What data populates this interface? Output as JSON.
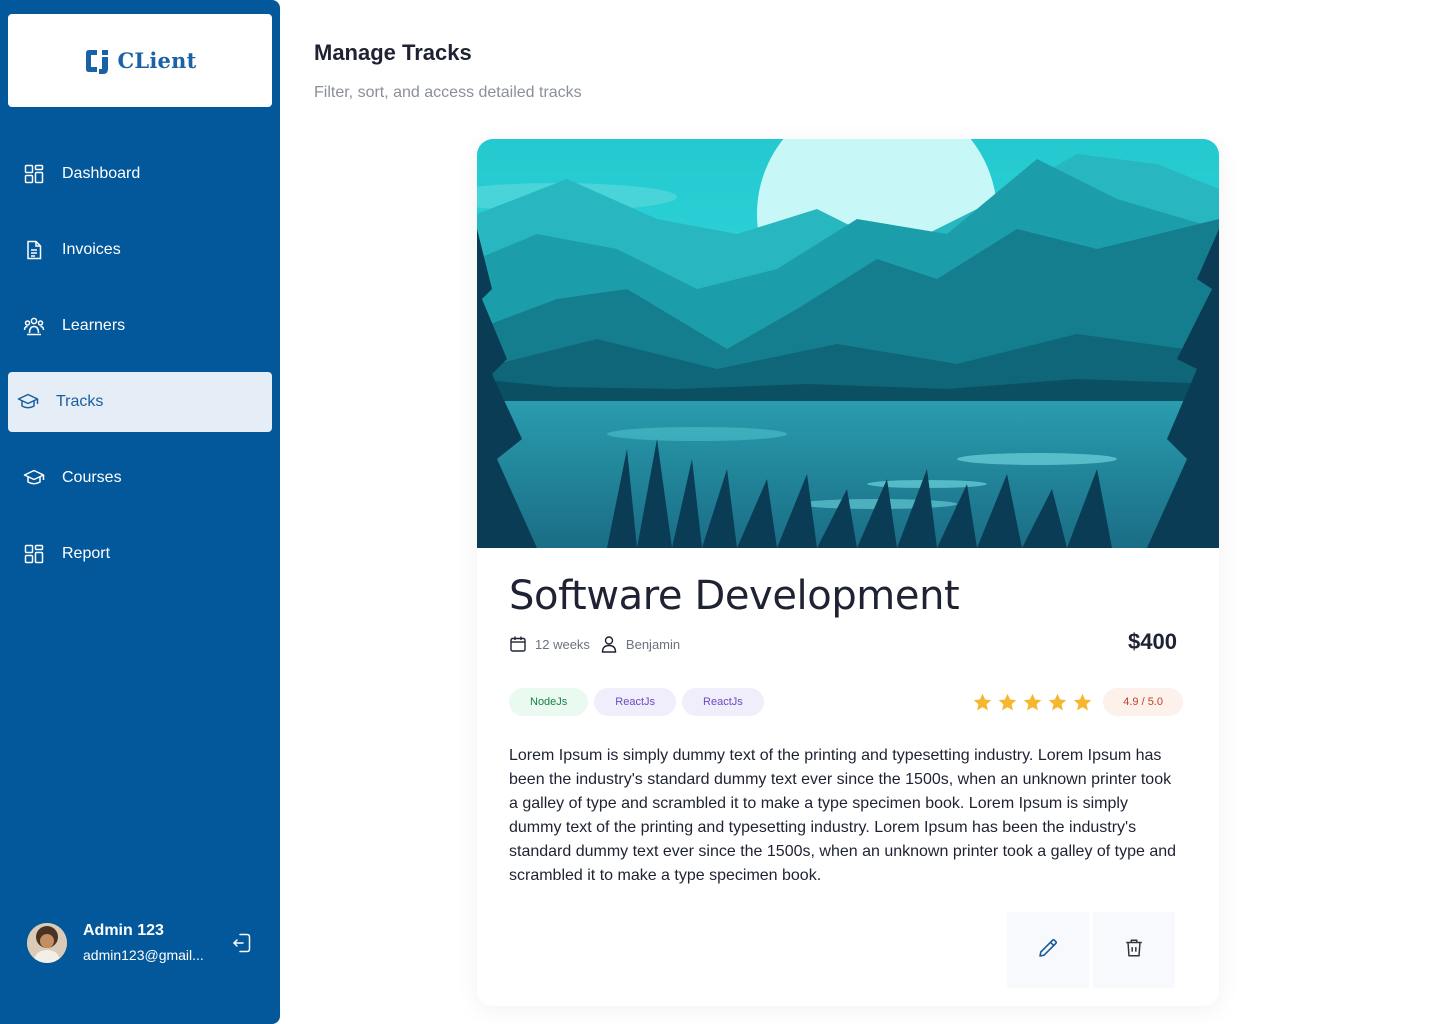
{
  "app": {
    "logo_text": "CLient",
    "brand_color": "#03579b"
  },
  "sidebar": {
    "items": [
      {
        "label": "Dashboard",
        "icon": "grid-icon",
        "active": false
      },
      {
        "label": "Invoices",
        "icon": "document-icon",
        "active": false
      },
      {
        "label": "Learners",
        "icon": "people-icon",
        "active": false
      },
      {
        "label": "Tracks",
        "icon": "graduation-cap-icon",
        "active": true
      },
      {
        "label": "Courses",
        "icon": "graduation-cap-icon",
        "active": false
      },
      {
        "label": "Report",
        "icon": "grid-icon",
        "active": false
      }
    ],
    "user": {
      "name": "Admin 123",
      "email": "admin123@gmail..."
    }
  },
  "header": {
    "title": "Manage Tracks",
    "subtitle": "Filter, sort, and access detailed tracks"
  },
  "track": {
    "title": "Software Development",
    "duration": "12 weeks",
    "instructor": "Benjamin",
    "price": "$400",
    "tags": [
      {
        "label": "NodeJs",
        "color": "green"
      },
      {
        "label": "ReactJs",
        "color": "purple"
      },
      {
        "label": "ReactJs",
        "color": "purple"
      }
    ],
    "rating": {
      "stars": 5,
      "label": "4.9 / 5.0"
    },
    "description": "Lorem Ipsum is simply dummy text of the printing and typesetting industry. Lorem Ipsum has been the industry's standard dummy text ever since the 1500s, when an unknown printer took a galley of type and scrambled it to make a type specimen book. Lorem Ipsum is simply dummy text of the printing and typesetting industry. Lorem Ipsum has been the industry's standard dummy text ever since the 1500s, when an unknown printer took a galley of type and scrambled it to make a type specimen book."
  }
}
